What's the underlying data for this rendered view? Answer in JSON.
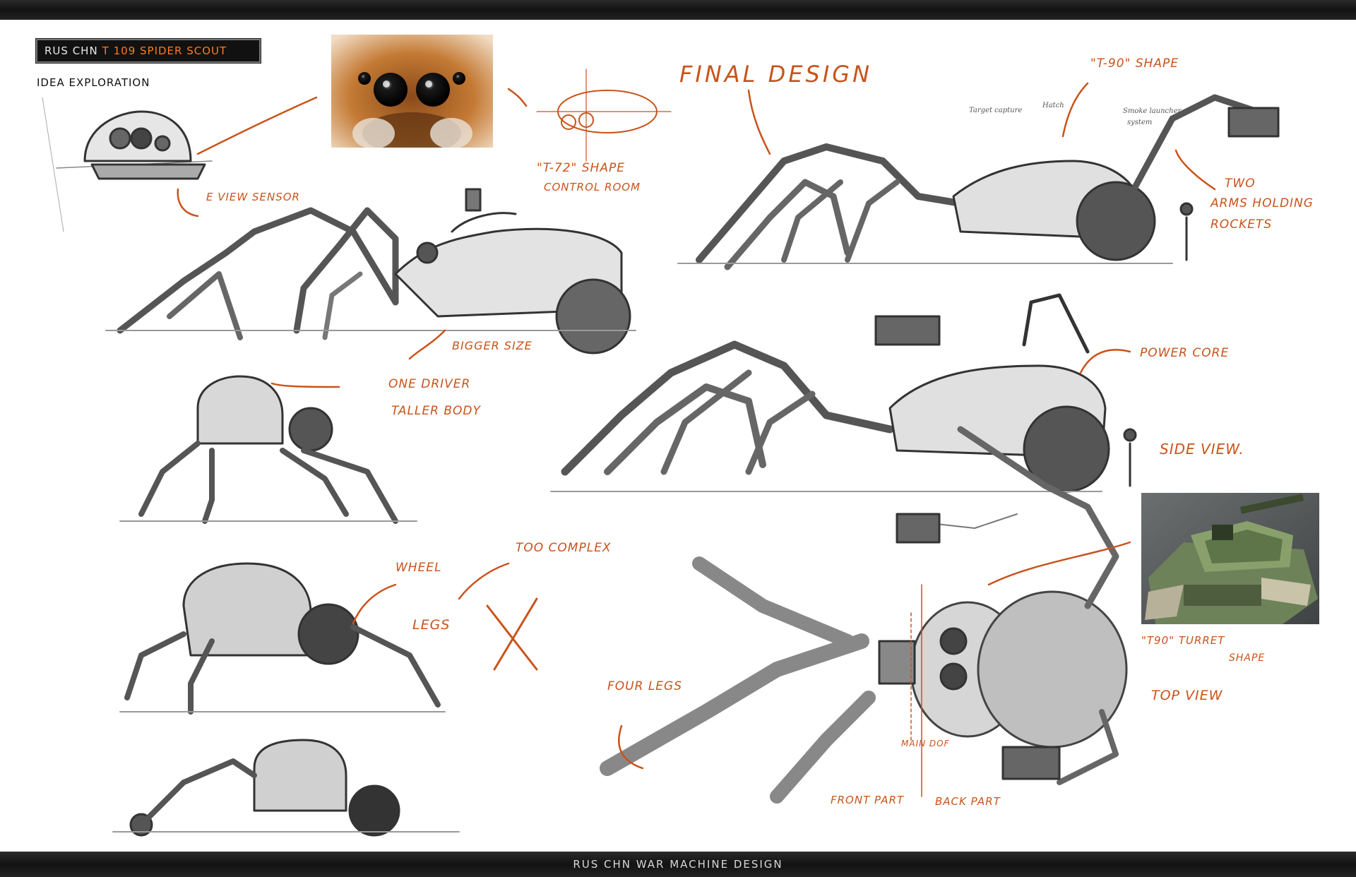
{
  "header": {
    "title_prefix": "RUS CHN",
    "title_main": "T 109 SPIDER SCOUT",
    "section": "IDEA EXPLORATION"
  },
  "footer": {
    "text": "RUS CHN WAR MACHINE DESIGN"
  },
  "annotations": {
    "final_design": "FINAL DESIGN",
    "t72_shape": "\"T-72\" SHAPE",
    "control_room": "CONTROL ROOM",
    "eye_view_sensor": "E VIEW SENSOR",
    "bigger_size": "BIGGER SIZE",
    "one_driver": "ONE DRIVER",
    "taller_body": "TALLER BODY",
    "wheel": "WHEEL",
    "legs": "LEGS",
    "too_complex": "TOO COMPLEX",
    "t90_shape": "\"T-90\" SHAPE",
    "target_capture": "Target capture",
    "hatch": "Hatch",
    "smoke_launcher": "Smoke launcher",
    "system": "system",
    "two_arms_1": "TWO",
    "two_arms_2": "ARMS HOLDING",
    "two_arms_3": "ROCKETS",
    "power_core": "POWER CORE",
    "side_view": "SIDE VIEW.",
    "t90_turret_1": "\"T90\" TURRET",
    "t90_turret_2": "SHAPE",
    "top_view": "TOP VIEW",
    "four_legs": "FOUR LEGS",
    "main_dof": "MAIN DOF",
    "front_part": "FRONT PART",
    "back_part": "BACK PART"
  },
  "colors": {
    "annotation": "#c9531a",
    "title_accent": "#ff7a1f",
    "sketch": "#333333"
  }
}
